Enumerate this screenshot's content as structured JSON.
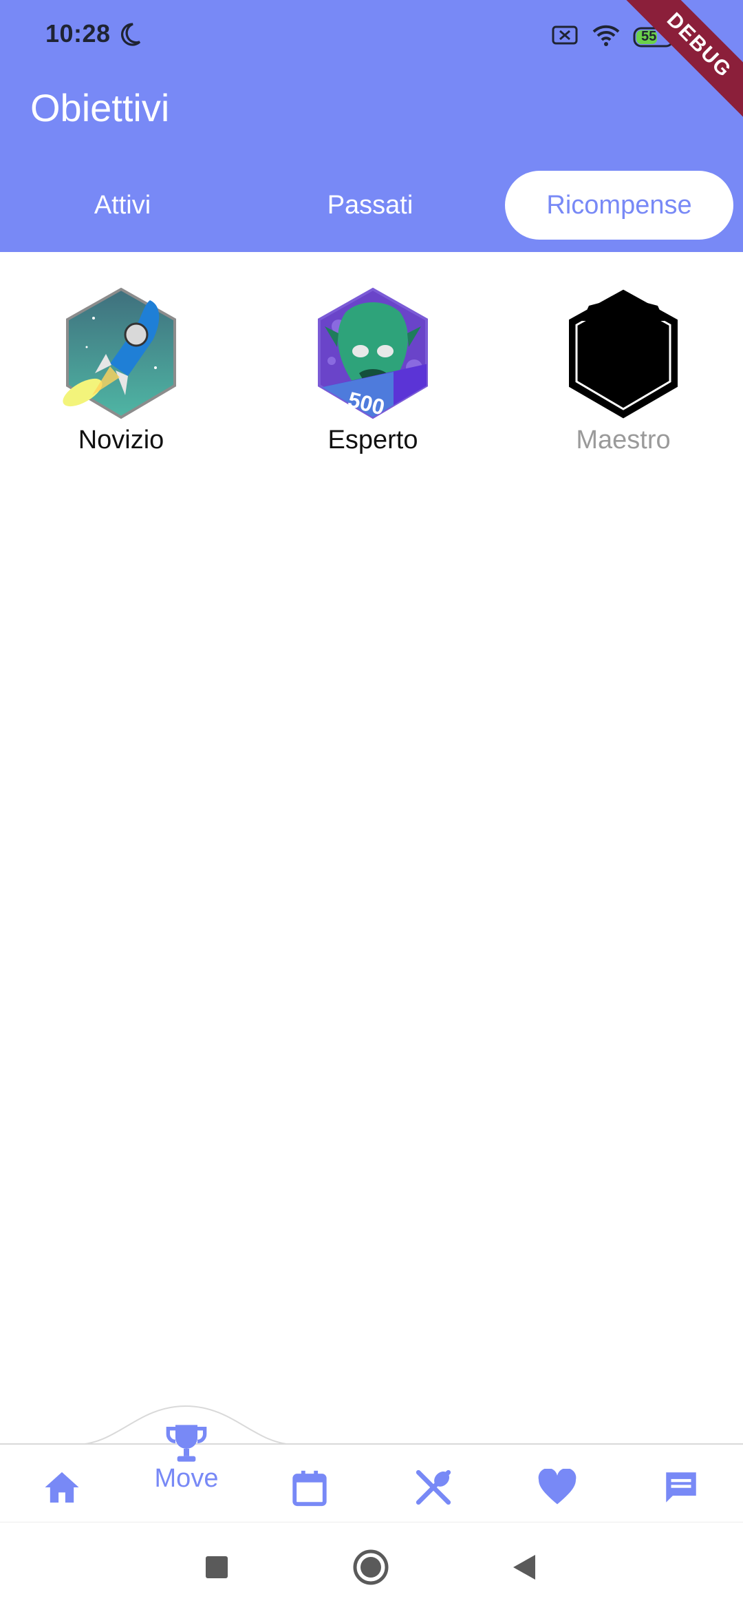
{
  "status_bar": {
    "time": "10:28",
    "battery": "55",
    "debug_banner": "DEBUG"
  },
  "app_bar": {
    "title": "Obiettivi"
  },
  "tabs": [
    {
      "label": "Attivi",
      "active": false
    },
    {
      "label": "Passati",
      "active": false
    },
    {
      "label": "Ricompense",
      "active": true
    }
  ],
  "badges": [
    {
      "label": "Novizio",
      "locked": false,
      "icon": "rocket-badge-icon"
    },
    {
      "label": "Esperto",
      "locked": false,
      "icon": "monster-500-badge-icon",
      "badge_text": "500"
    },
    {
      "label": "Maestro",
      "locked": true,
      "icon": "locked-gift-badge-icon"
    }
  ],
  "bottom_nav": {
    "items": [
      {
        "icon": "home-icon"
      },
      {
        "icon": "trophy-icon",
        "label": "Move",
        "active": true
      },
      {
        "icon": "calendar-icon"
      },
      {
        "icon": "utensils-icon"
      },
      {
        "icon": "heart-icon"
      },
      {
        "icon": "chat-icon"
      }
    ]
  },
  "colors": {
    "primary": "#7889f6",
    "debug": "#8b1f3a",
    "locked_text": "#9a9a9a"
  }
}
